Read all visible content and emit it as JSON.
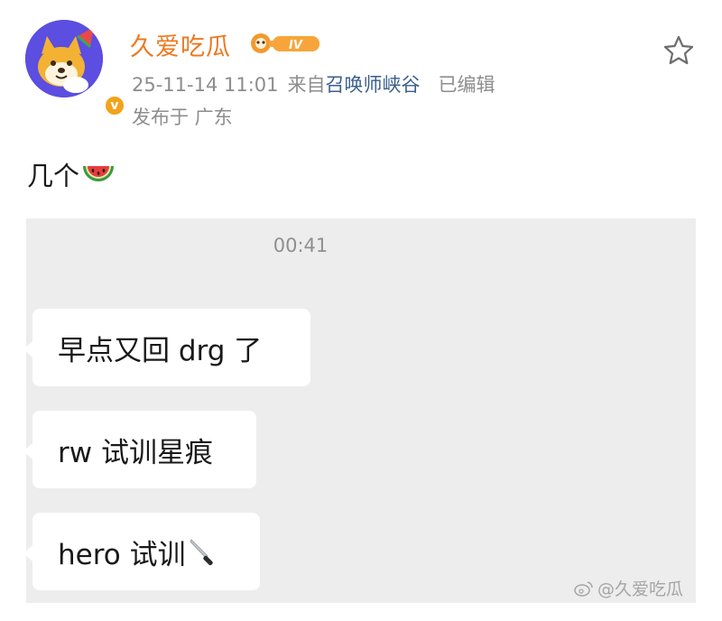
{
  "header": {
    "username": "久爱吃瓜",
    "vip_badge_text": "IV",
    "verify_badge": "v",
    "timestamp": "25-11-14 11:01",
    "source_prefix": "来自",
    "source": "召唤师峡谷",
    "edited": "已编辑",
    "location": "发布于 广东"
  },
  "post": {
    "text": "几个",
    "text_emoji": "watermelon-emoji"
  },
  "screenshot": {
    "chat_time": "00:41",
    "messages": [
      {
        "text": "早点又回 drg 了"
      },
      {
        "text": "rw 试训星痕"
      },
      {
        "text": "hero 试训",
        "emoji": "knife-emoji"
      }
    ]
  },
  "watermark": {
    "text": "@久爱吃瓜",
    "icon": "weibo-icon"
  },
  "icons": {
    "favorite": "star-outline-icon"
  },
  "colors": {
    "username": "#ea7a21",
    "source_link": "#3a5e8e",
    "meta": "#8d8d8d",
    "screenshot_bg": "#ededed",
    "avatar_bg": "#5b4ee0",
    "verify_badge": "#f2a31b"
  }
}
